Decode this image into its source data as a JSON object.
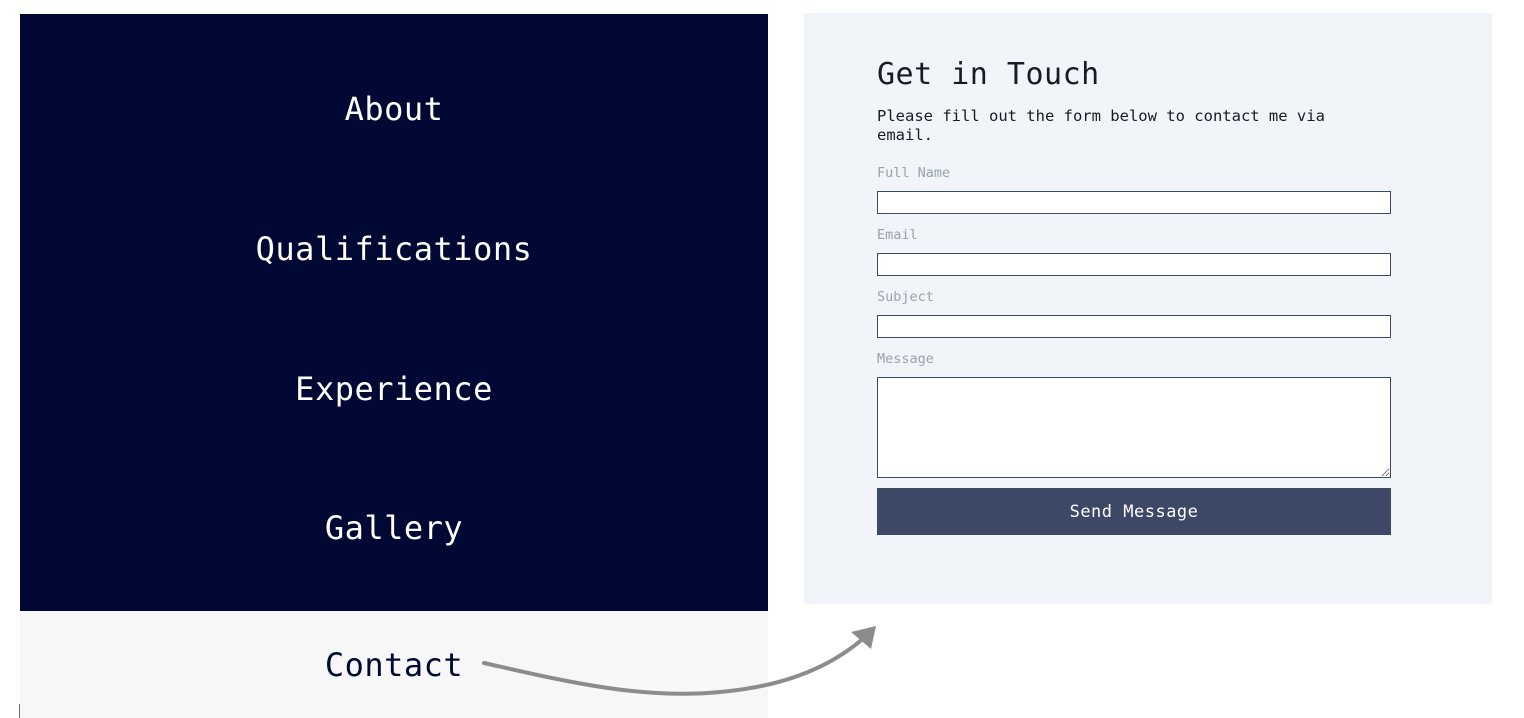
{
  "nav": {
    "items": [
      {
        "label": "About",
        "active": false
      },
      {
        "label": "Qualifications",
        "active": false
      },
      {
        "label": "Experience",
        "active": false
      },
      {
        "label": "Gallery",
        "active": false
      },
      {
        "label": "Contact",
        "active": true
      }
    ]
  },
  "contact_form": {
    "title": "Get in Touch",
    "description": "Please fill out the form below to contact me via email.",
    "fields": {
      "full_name": {
        "label": "Full Name",
        "value": ""
      },
      "email": {
        "label": "Email",
        "value": ""
      },
      "subject": {
        "label": "Subject",
        "value": ""
      },
      "message": {
        "label": "Message",
        "value": ""
      }
    },
    "submit_label": "Send Message"
  },
  "colors": {
    "nav_background": "#000833",
    "nav_active_background": "#f7f7f8",
    "form_background": "#f1f4f8",
    "button_background": "#3c4865",
    "field_border": "#3b4866",
    "label_text": "#9aa1ad",
    "annotation_arrow": "#8c8c8c"
  }
}
